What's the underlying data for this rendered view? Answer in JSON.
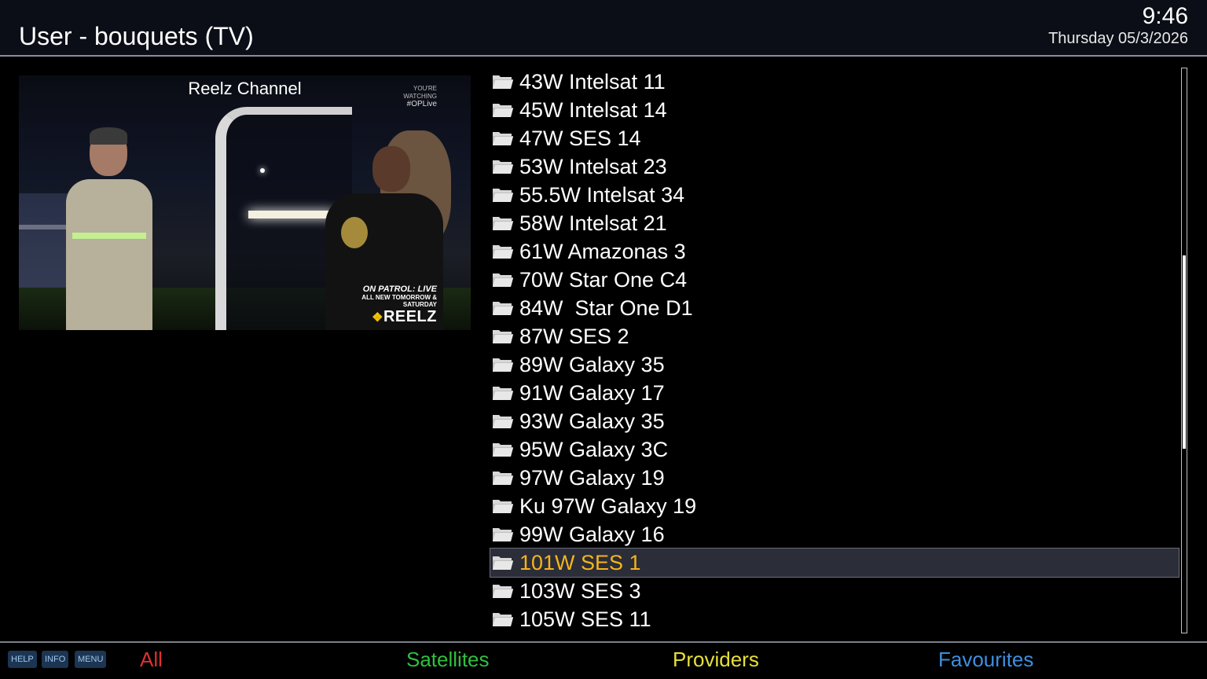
{
  "header": {
    "title": "User - bouquets (TV)",
    "time": "9:46",
    "date": "Thursday 05/3/2026"
  },
  "preview": {
    "channel_name": "Reelz Channel",
    "overlay_watching": "YOU'RE WATCHING",
    "overlay_hashtag": "#OPLive",
    "overlay_show": "ON PATROL: LIVE",
    "overlay_schedule": "ALL NEW TOMORROW & SATURDAY",
    "overlay_network": "REELZ"
  },
  "bouquets": [
    {
      "label": "43W Intelsat 11",
      "icon": "folder-icon"
    },
    {
      "label": "45W Intelsat 14",
      "icon": "folder-icon"
    },
    {
      "label": "47W SES 14",
      "icon": "folder-icon"
    },
    {
      "label": "53W Intelsat 23",
      "icon": "folder-icon"
    },
    {
      "label": "55.5W Intelsat 34",
      "icon": "folder-icon"
    },
    {
      "label": "58W Intelsat 21",
      "icon": "folder-icon"
    },
    {
      "label": "61W Amazonas 3",
      "icon": "folder-icon"
    },
    {
      "label": "70W Star One C4",
      "icon": "folder-icon"
    },
    {
      "label": "84W  Star One D1",
      "icon": "folder-icon"
    },
    {
      "label": "87W SES 2",
      "icon": "folder-icon"
    },
    {
      "label": "89W Galaxy 35",
      "icon": "folder-icon"
    },
    {
      "label": "91W Galaxy 17",
      "icon": "folder-icon"
    },
    {
      "label": "93W Galaxy 35",
      "icon": "folder-icon"
    },
    {
      "label": "95W Galaxy 3C",
      "icon": "folder-icon"
    },
    {
      "label": "97W Galaxy 19",
      "icon": "folder-icon"
    },
    {
      "label": "Ku 97W Galaxy 19",
      "icon": "folder-icon"
    },
    {
      "label": "99W Galaxy 16",
      "icon": "folder-icon"
    },
    {
      "label": "101W SES 1",
      "icon": "folder-icon",
      "selected": true
    },
    {
      "label": "103W SES 3",
      "icon": "folder-icon"
    },
    {
      "label": "105W SES 11",
      "icon": "folder-icon"
    }
  ],
  "footer": {
    "keys": [
      "HELP",
      "INFO",
      "MENU"
    ],
    "red": "All",
    "green": "Satellites",
    "yellow": "Providers",
    "blue": "Favourites"
  },
  "colors": {
    "selected_text": "#f5b51b",
    "red": "#e03030",
    "green": "#2fbf3f",
    "yellow": "#e6e03a",
    "blue": "#3d8fe0"
  }
}
